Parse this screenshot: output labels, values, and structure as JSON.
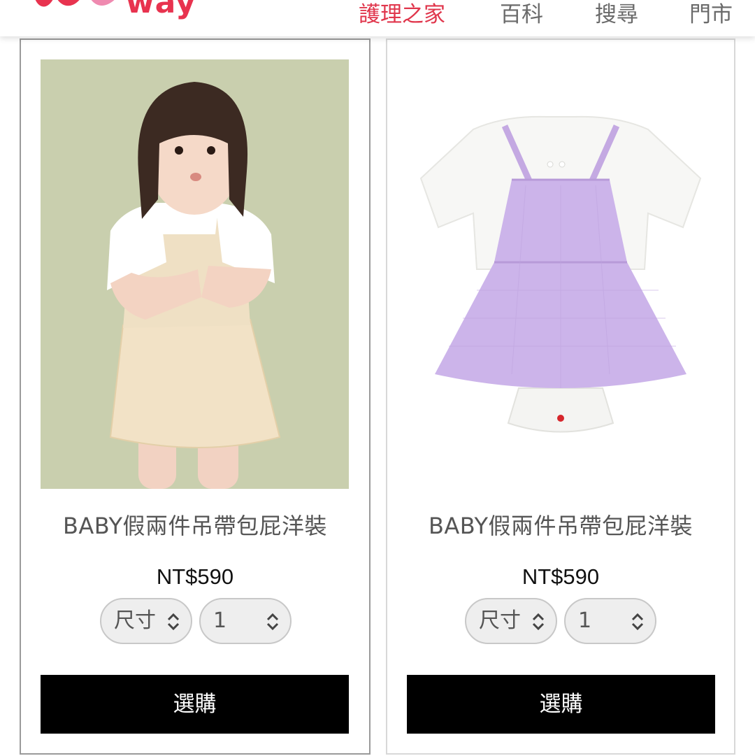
{
  "header": {
    "logo_text": "way",
    "nav": [
      "護理之家",
      "百科",
      "搜尋",
      "門市"
    ]
  },
  "colors": {
    "accent": "#e0364c",
    "logo_pink": "#e8334f",
    "button_bg": "#000000"
  },
  "products": [
    {
      "name": "BABY假兩件吊帶包屁洋裝",
      "price": "NT$590",
      "size_label": "尺寸",
      "qty": "1",
      "buy_label": "選購",
      "image": "baby-girl-in-beige-dress-photo"
    },
    {
      "name": "BABY假兩件吊帶包屁洋裝",
      "price": "NT$590",
      "size_label": "尺寸",
      "qty": "1",
      "buy_label": "選購",
      "image": "lavender-gingham-bodysuit-dress-photo"
    }
  ],
  "icons": {
    "chevron": "chevron-up-down-icon"
  }
}
